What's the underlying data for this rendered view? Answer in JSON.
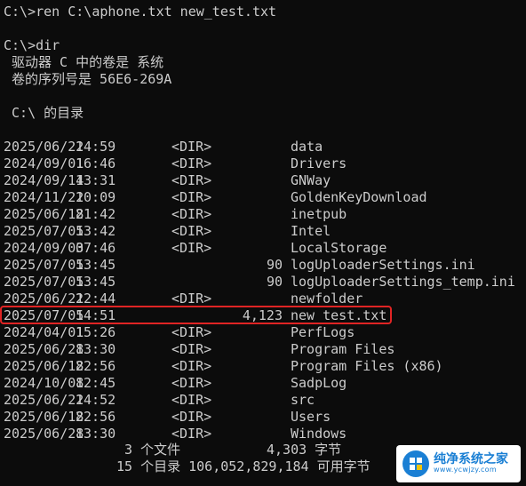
{
  "console": {
    "cmd1": "C:\\>ren C:\\aphone.txt new_test.txt",
    "cmd2": "C:\\>dir",
    "volume_line": " 驱动器 C 中的卷是 系统",
    "serial_line": " 卷的序列号是 56E6-269A",
    "dir_of_line": " C:\\ 的目录",
    "entries": [
      {
        "date": "2025/06/22",
        "time": "14:59",
        "dir": "<DIR>",
        "size": "",
        "name": "data"
      },
      {
        "date": "2024/09/01",
        "time": "16:46",
        "dir": "<DIR>",
        "size": "",
        "name": "Drivers"
      },
      {
        "date": "2024/09/14",
        "time": "13:31",
        "dir": "<DIR>",
        "size": "",
        "name": "GNWay"
      },
      {
        "date": "2024/11/22",
        "time": "10:09",
        "dir": "<DIR>",
        "size": "",
        "name": "GoldenKeyDownload"
      },
      {
        "date": "2025/06/18",
        "time": "21:42",
        "dir": "<DIR>",
        "size": "",
        "name": "inetpub"
      },
      {
        "date": "2025/07/05",
        "time": "13:42",
        "dir": "<DIR>",
        "size": "",
        "name": "Intel"
      },
      {
        "date": "2024/09/03",
        "time": "07:46",
        "dir": "<DIR>",
        "size": "",
        "name": "LocalStorage"
      },
      {
        "date": "2025/07/05",
        "time": "13:45",
        "dir": "",
        "size": "90",
        "name": "logUploaderSettings.ini"
      },
      {
        "date": "2025/07/05",
        "time": "13:45",
        "dir": "",
        "size": "90",
        "name": "logUploaderSettings_temp.ini"
      },
      {
        "date": "2025/06/21",
        "time": "22:44",
        "dir": "<DIR>",
        "size": "",
        "name": "newfolder"
      },
      {
        "date": "2025/07/05",
        "time": "14:51",
        "dir": "",
        "size": "4,123",
        "name": "new_test.txt"
      },
      {
        "date": "2024/04/01",
        "time": "15:26",
        "dir": "<DIR>",
        "size": "",
        "name": "PerfLogs"
      },
      {
        "date": "2025/06/28",
        "time": "13:30",
        "dir": "<DIR>",
        "size": "",
        "name": "Program Files"
      },
      {
        "date": "2025/06/18",
        "time": "22:56",
        "dir": "<DIR>",
        "size": "",
        "name": "Program Files (x86)"
      },
      {
        "date": "2024/10/08",
        "time": "12:45",
        "dir": "<DIR>",
        "size": "",
        "name": "SadpLog"
      },
      {
        "date": "2025/06/22",
        "time": "14:52",
        "dir": "<DIR>",
        "size": "",
        "name": "src"
      },
      {
        "date": "2025/06/18",
        "time": "22:56",
        "dir": "<DIR>",
        "size": "",
        "name": "Users"
      },
      {
        "date": "2025/06/28",
        "time": "13:30",
        "dir": "<DIR>",
        "size": "",
        "name": "Windows"
      }
    ],
    "summary_files_count": "3 个文件",
    "summary_files_bytes": "4,303 字节",
    "summary_dirs": "15 个目录 106,052,829,184 可用字节"
  },
  "watermark": {
    "title": "纯净系统之家",
    "url": "www.ycwjzy.com"
  },
  "colors": {
    "background": "#0c0c0c",
    "text": "#cccccc",
    "highlight": "#e02424",
    "watermark_accent": "#1a7fd4"
  }
}
